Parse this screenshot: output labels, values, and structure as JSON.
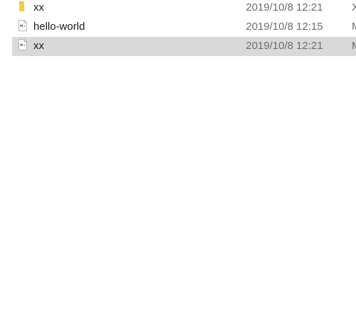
{
  "files": [
    {
      "name": "xx",
      "modified": "2019/10/8 12:21",
      "type_fragment": "X",
      "icon": "folder-icon",
      "selected": false
    },
    {
      "name": "hello-world",
      "modified": "2019/10/8 12:15",
      "type_fragment": "M",
      "icon": "markdown-file-icon",
      "selected": false
    },
    {
      "name": "xx",
      "modified": "2019/10/8 12:21",
      "type_fragment": "M",
      "icon": "markdown-file-icon",
      "selected": true
    }
  ],
  "colors": {
    "folder": "#f7c948",
    "selected_row": "#d9d9d9",
    "date_text": "#6d6d6d"
  }
}
